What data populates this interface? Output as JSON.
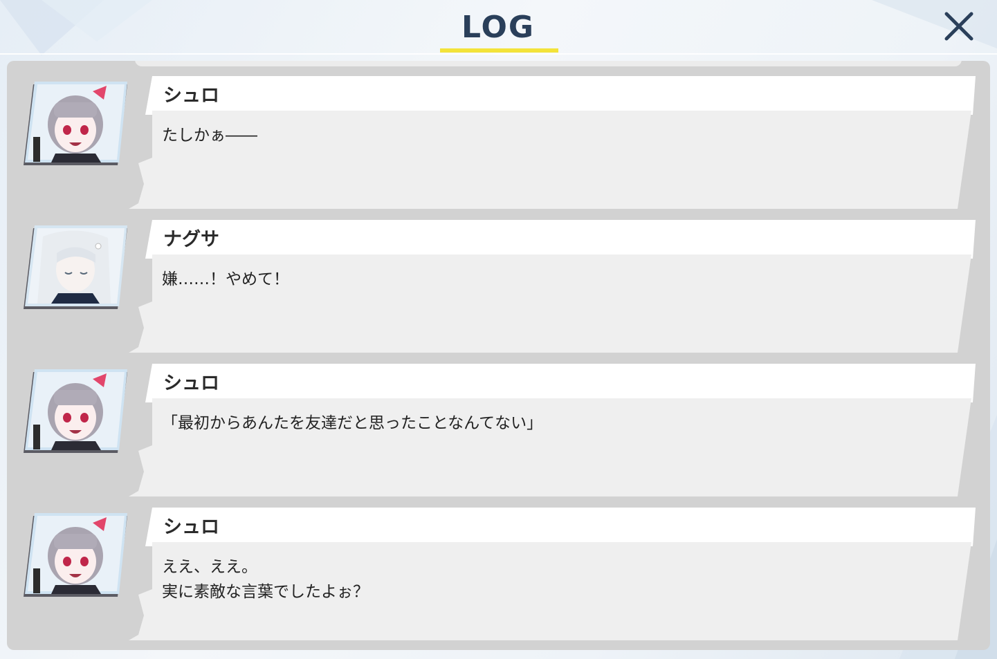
{
  "window": {
    "title": "LOG",
    "close_icon": "close-x-icon",
    "accent_color": "#f3e33a",
    "title_color": "#2a3f5a"
  },
  "log": {
    "entries": [
      {
        "speaker": "シュロ",
        "message": "たしかぁ――",
        "portrait": "shuro-portrait"
      },
      {
        "speaker": "ナグサ",
        "message": "嫌……！やめて！",
        "portrait": "nagusa-portrait"
      },
      {
        "speaker": "シュロ",
        "message": "「最初からあんたを友達だと思ったことなんてない」",
        "portrait": "shuro-portrait"
      },
      {
        "speaker": "シュロ",
        "message": "ええ、ええ。\n実に素敵な言葉でしたよぉ？",
        "portrait": "shuro-portrait"
      }
    ]
  }
}
